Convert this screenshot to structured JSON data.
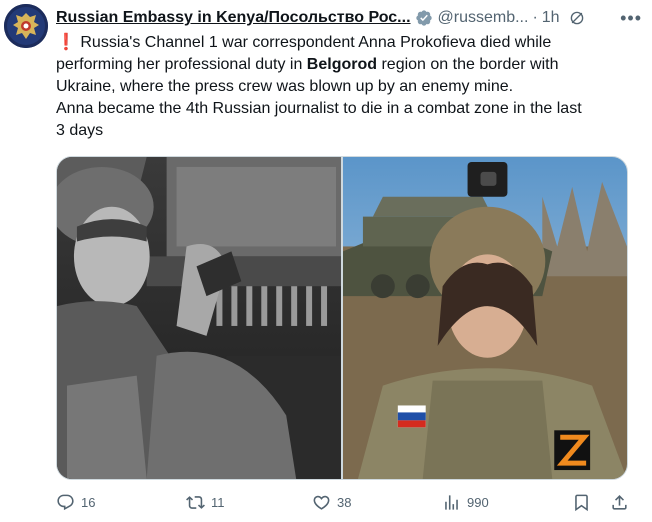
{
  "author": {
    "name": "Russian Embassy in Kenya/Посольство Рос...",
    "handle": "@russemb...",
    "separator": "·",
    "time": "1h"
  },
  "tweet": {
    "line1_prefix": "❗",
    "line1": "Russia's Channel 1 war correspondent Anna Prokofieva died while",
    "line2_before": "performing her professional duty in ",
    "line2_bold": "Belgorod",
    "line2_after": " region on the border with",
    "line3": "Ukraine, where the press crew was blown up by an enemy mine.",
    "line4": "Anna became the 4th Russian journalist to die in a combat zone in the last",
    "line5": "3 days"
  },
  "actions": {
    "replies": "16",
    "reposts": "11",
    "likes": "38",
    "views": "990"
  },
  "icons": {
    "avatar": "coat-of-arms-icon",
    "verified": "verified-badge-icon",
    "grok": "grok-icon",
    "more": "more-icon",
    "reply": "reply-icon",
    "retweet": "retweet-icon",
    "like": "heart-icon",
    "views": "views-icon",
    "bookmark": "bookmark-icon",
    "share": "share-icon"
  },
  "colors": {
    "accent": "#1d9bf0",
    "secondary_text": "#536471",
    "exclamation": "#e0245e",
    "verified_badge": "#829aab"
  }
}
